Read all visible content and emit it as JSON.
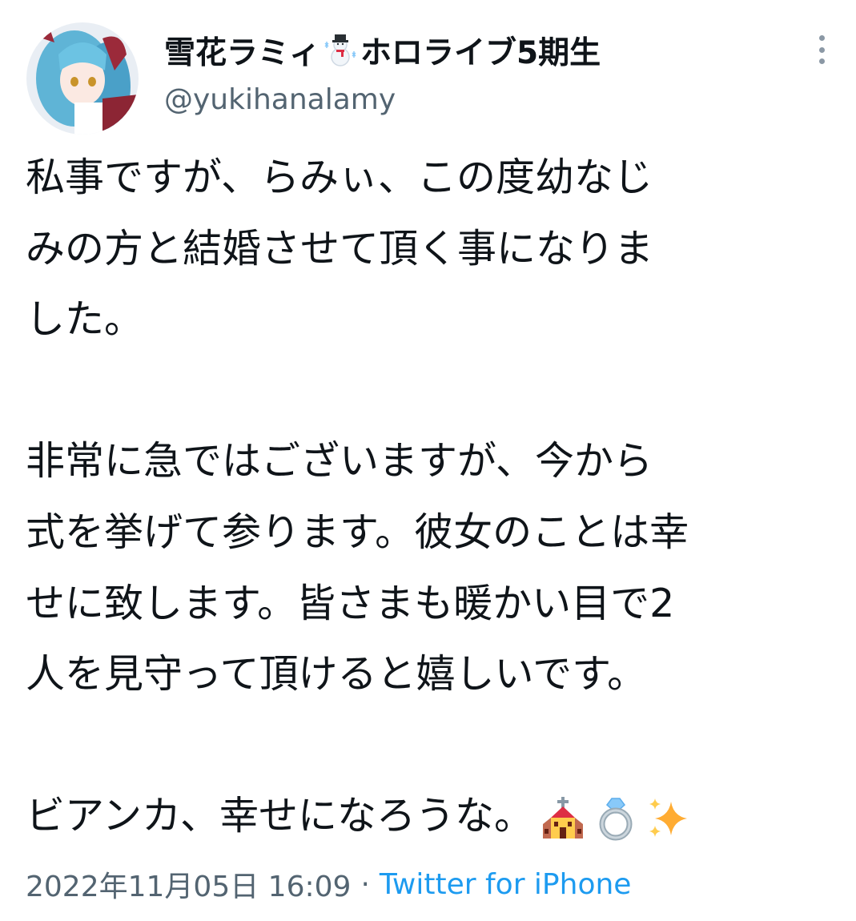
{
  "author": {
    "display_name_part1": "雪花ラミィ",
    "display_name_part2": "ホロライブ5期生",
    "name_emoji": "snowman-emoji",
    "handle": "@yukihanalamy",
    "avatar": "avatar-image"
  },
  "tweet": {
    "para1": [
      "私事ですが、らみぃ、この度幼なじ",
      "みの方と結婚させて頂く事になりま",
      "した。"
    ],
    "para2": [
      "非常に急ではございますが、今から",
      "式を挙げて参ります。彼女のことは幸",
      "せに致します。皆さまも暖かい目で2",
      "人を見守って頂けると嬉しいです。"
    ],
    "para3": "ビアンカ、幸せになろうな。",
    "emojis": [
      "church-emoji",
      "ring-emoji",
      "sparkles-emoji"
    ]
  },
  "meta": {
    "timestamp": "2022年11月05日 16:09",
    "separator": "·",
    "source": "Twitter for iPhone"
  },
  "icons": {
    "more": "more-vertical-icon"
  },
  "colors": {
    "text": "#0f1419",
    "secondary": "#536471",
    "link": "#1d9bf0"
  }
}
